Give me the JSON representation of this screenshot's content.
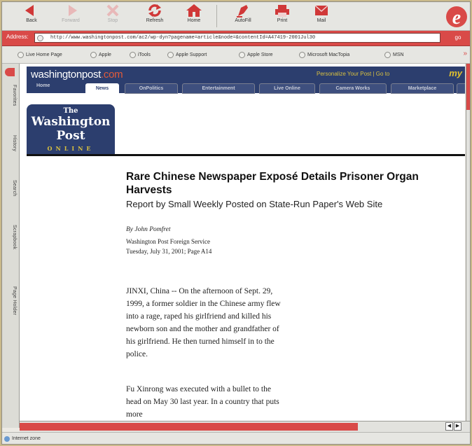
{
  "toolbar": {
    "back": "Back",
    "forward": "Forward",
    "stop": "Stop",
    "refresh": "Refresh",
    "home": "Home",
    "autofill": "AutoFill",
    "print": "Print",
    "mail": "Mail"
  },
  "address": {
    "label": "Address:",
    "url": "http://www.washingtonpost.com/ac2/wp-dyn?pagename=article&node=&contentId=A47419-2001Jul30",
    "go": "go"
  },
  "favorites": [
    "Live Home Page",
    "Apple",
    "iTools",
    "Apple Support",
    "Apple Store",
    "Microsoft MacTopia",
    "MSN"
  ],
  "sidebar_tabs": [
    "Favorites",
    "History",
    "Search",
    "Scrapbook",
    "Page Holder"
  ],
  "site": {
    "logo_main": "washingtonpost",
    "logo_com": ".com",
    "personalize": "Personalize Your Post | Go to",
    "my": "my",
    "tabs": [
      "Home",
      "News",
      "OnPolitics",
      "Entertainment",
      "Live Online",
      "Camera Works",
      "Marketplace"
    ],
    "masthead": [
      "The",
      "Washington",
      "Post",
      "ONLINE"
    ]
  },
  "article": {
    "headline": "Rare Chinese Newspaper Exposé Details Prisoner Organ Harvests",
    "subhead": "Report by Small Weekly Posted on State-Run Paper's Web Site",
    "byline": "By John Pomfret",
    "service": "Washington Post Foreign Service",
    "date": "Tuesday, July 31, 2001; Page A14",
    "paragraphs": [
      "JINXI, China -- On the afternoon of Sept. 29, 1999, a former soldier in the Chinese army flew into a rage, raped his girlfriend and killed his newborn son and the mother and grandfather of his girlfriend. He then turned himself in to the police.",
      "Fu Xinrong was executed with a bullet to the head on May 30 last year. In a country that puts more"
    ]
  },
  "status": {
    "text": "Internet zone"
  }
}
